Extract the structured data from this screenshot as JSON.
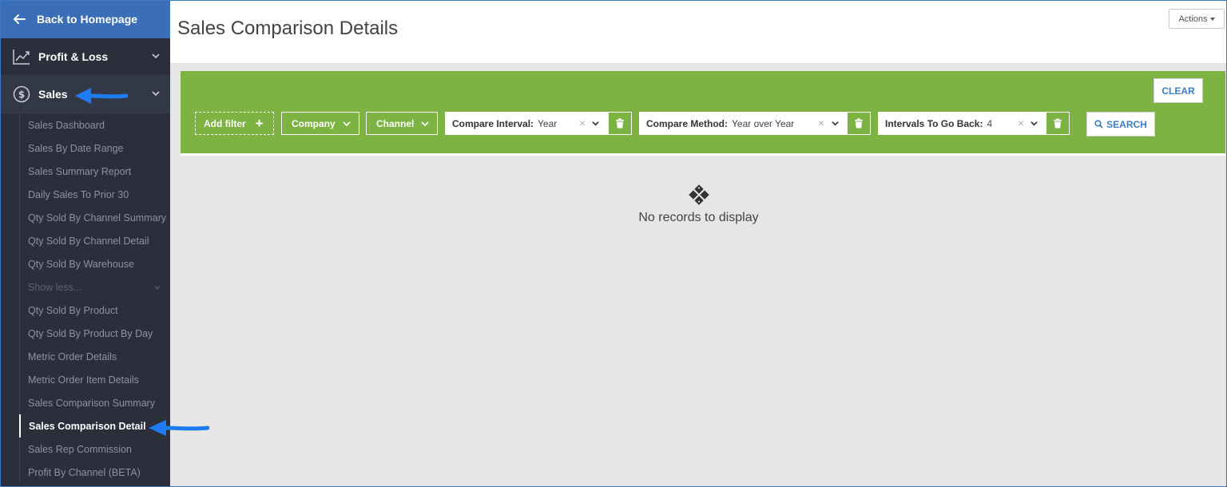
{
  "sidebar": {
    "back_label": "Back to Homepage",
    "sections": [
      {
        "label": "Profit & Loss",
        "icon": "chart-line-icon"
      },
      {
        "label": "Sales",
        "icon": "dollar-circle-icon"
      }
    ],
    "items": [
      "Sales Dashboard",
      "Sales By Date Range",
      "Sales Summary Report",
      "Daily Sales To Prior 30",
      "Qty Sold By Channel Summary",
      "Qty Sold By Channel Detail",
      "Qty Sold By Warehouse",
      "Show less...",
      "Qty Sold By Product",
      "Qty Sold By Product By Day",
      "Metric Order Details",
      "Metric Order Item Details",
      "Sales Comparison Summary",
      "Sales Comparison Detail",
      "Sales Rep Commission",
      "Profit By Channel (BETA)"
    ],
    "active_item": "Sales Comparison Detail"
  },
  "header": {
    "title": "Sales Comparison Details",
    "actions_label": "Actions"
  },
  "filters": {
    "clear_label": "CLEAR",
    "add_filter_label": "Add filter",
    "company_label": "Company",
    "channel_label": "Channel",
    "compare_interval": {
      "label": "Compare Interval:",
      "value": "Year"
    },
    "compare_method": {
      "label": "Compare Method:",
      "value": "Year over Year"
    },
    "intervals_back": {
      "label": "Intervals To Go Back:",
      "value": "4"
    },
    "search_label": "SEARCH"
  },
  "empty_state": {
    "text": "No records to display"
  },
  "colors": {
    "sidebar_bg": "#2a2f3b",
    "back_bg": "#3a6fb8",
    "filter_bg": "#7cb342",
    "accent_blue": "#3a7cc8",
    "annotation_arrow": "#1e7cf2"
  }
}
